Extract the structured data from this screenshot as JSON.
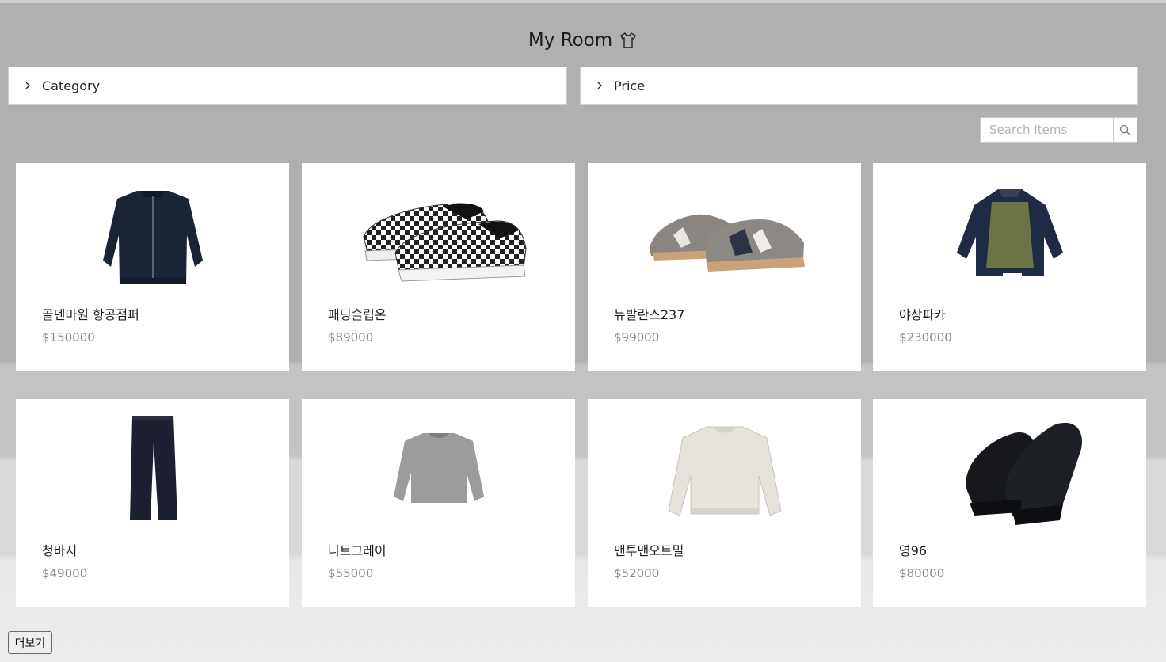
{
  "header": {
    "title": "My Room",
    "icon": "tshirt-icon"
  },
  "filters": [
    {
      "label": "Category",
      "icon": "chevron-right-icon"
    },
    {
      "label": "Price",
      "icon": "chevron-right-icon"
    }
  ],
  "search": {
    "placeholder": "Search Items",
    "value": "",
    "icon": "search-icon"
  },
  "products": [
    {
      "name": "골덴마원 항공점퍼",
      "price": "$150000",
      "image": "bomber-jacket"
    },
    {
      "name": "패딩슬립온",
      "price": "$89000",
      "image": "checkered-slip-on"
    },
    {
      "name": "뉴발란스237",
      "price": "$99000",
      "image": "new-balance-sneaker"
    },
    {
      "name": "야상파카",
      "price": "$230000",
      "image": "field-parka"
    },
    {
      "name": "청바지",
      "price": "$49000",
      "image": "jeans"
    },
    {
      "name": "니트그레이",
      "price": "$55000",
      "image": "gray-knit"
    },
    {
      "name": "맨투맨오트밀",
      "price": "$52000",
      "image": "oatmeal-sweatshirt"
    },
    {
      "name": "영96",
      "price": "$80000",
      "image": "black-sneaker"
    }
  ],
  "load_more": {
    "label": "더보기"
  },
  "colors": {
    "page_background": "#b0b0b0",
    "card_background": "#ffffff",
    "price_text": "#8a8a8a"
  }
}
